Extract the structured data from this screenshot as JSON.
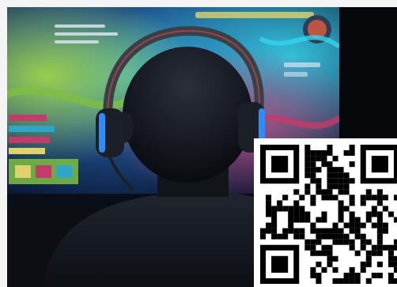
{
  "photo": {
    "subject": "person-wearing-headset-icon",
    "screen_theme_colors": [
      "#1f3f7a",
      "#2ea6c7",
      "#7dbf43",
      "#c43b6a",
      "#e0d26a"
    ]
  },
  "qr_code": {
    "icon": "qr-code-icon",
    "module_color": "#000000",
    "background_color": "#ffffff"
  }
}
